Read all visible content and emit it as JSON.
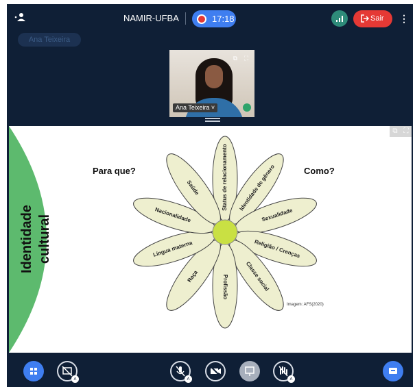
{
  "topbar": {
    "room_title": "NAMIR-UFBA",
    "recording_time": "17:18",
    "leave_label": "Sair",
    "participants_icon": "participants-icon",
    "menu_icon": "kebab-menu-icon"
  },
  "speaker_chip": {
    "name": "Ana Teixeira"
  },
  "camera_tile": {
    "name": "Ana Teixeira"
  },
  "slide": {
    "left_title_line1": "Identidade",
    "left_title_line2": "cultural",
    "question_left": "Para que?",
    "question_right": "Como?",
    "credit": "Imagem: AFS(2020)",
    "petals": [
      {
        "label": "Status de relacionamento"
      },
      {
        "label": "Identidade de gênero"
      },
      {
        "label": "Sexualidade"
      },
      {
        "label": "Religião / Crenças"
      },
      {
        "label": "Classe social"
      },
      {
        "label": "Profissão"
      },
      {
        "label": "Raça"
      },
      {
        "label": "Língua materna"
      },
      {
        "label": "Nacionalidade"
      },
      {
        "label": "Saúde"
      }
    ]
  },
  "bottombar": {
    "buttons": [
      {
        "icon": "layout-grid-icon"
      },
      {
        "icon": "screen-share-off-icon"
      },
      {
        "icon": "microphone-off-icon"
      },
      {
        "icon": "camera-off-icon"
      },
      {
        "icon": "presentation-icon"
      },
      {
        "icon": "hand-raise-off-icon"
      },
      {
        "icon": "chat-icon"
      }
    ]
  },
  "colors": {
    "app_background": "#0f1f36",
    "accent_blue": "#3f7ef0",
    "leave_red": "#e53935",
    "petal_fill": "#eeefcf",
    "flower_center": "#c9e043",
    "side_arc": "#5dba6e"
  }
}
